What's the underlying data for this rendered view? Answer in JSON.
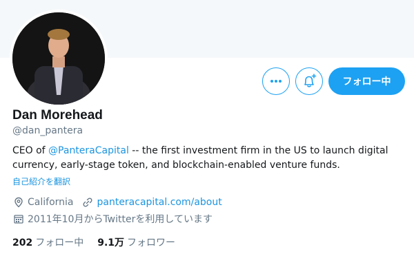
{
  "profile": {
    "name": "Dan Morehead",
    "handle": "@dan_pantera",
    "bio_prefix": "CEO of ",
    "bio_mention": "@PanteraCapital",
    "bio_line1_rest": " -- the first investment firm in the US to launch digital",
    "bio_line2": "currency, early-stage token, and blockchain-enabled venture funds.",
    "translate_label": "自己紹介を翻訳",
    "location": "California",
    "website": "panteracapital.com/about",
    "joined": "2011年10月からTwitterを利用しています"
  },
  "actions": {
    "follow_label": "フォロー中",
    "more_icon": "more-dots-icon",
    "notify_icon": "bell-plus-icon"
  },
  "stats": {
    "following_count": "202",
    "following_label": "フォロー中",
    "followers_count": "9.1万",
    "followers_label": "フォロワー"
  },
  "colors": {
    "accent": "#1da1f2",
    "link": "#1b95e0",
    "text": "#14171a",
    "secondary": "#657786",
    "banner": "#f5f8fa"
  }
}
